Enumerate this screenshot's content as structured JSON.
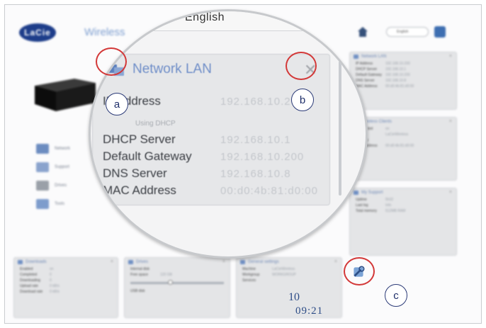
{
  "header": {
    "logo": "LaCie",
    "title": "Wireless",
    "lang_zoomed": "English",
    "lang_small": "English"
  },
  "network_panel": {
    "title": "Network LAN",
    "rows": [
      {
        "label": "IP Address",
        "value": "192.168.10.200"
      },
      {
        "label": "DHCP Server",
        "value": "192.168.10.1"
      },
      {
        "label": "Default Gateway",
        "value": "192.168.10.200"
      },
      {
        "label": "DNS Server",
        "value": "192.168.10.8"
      },
      {
        "label": "MAC Address",
        "value": "00:d0:4b:81:d0:00"
      }
    ],
    "sub_text": "Using DHCP"
  },
  "sidebar": {
    "items": [
      {
        "label": "Network"
      },
      {
        "label": "Support"
      },
      {
        "label": "Drives"
      },
      {
        "label": "Tools"
      }
    ]
  },
  "right_widgets": {
    "network": {
      "title": "Network LAN",
      "rows": [
        {
          "k": "IP Address",
          "v": "192.168.10.200"
        },
        {
          "k": "DHCP Server",
          "v": "192.168.10.1"
        },
        {
          "k": "Default Gateway",
          "v": "192.168.10.200"
        },
        {
          "k": "DNS Server",
          "v": "192.168.10.8"
        },
        {
          "k": "MAC Address",
          "v": "00:d0:4b:81:d0:00"
        }
      ]
    },
    "wireless": {
      "title": "Wireless Clients",
      "rows": [
        {
          "k": "Connected",
          "v": "on"
        },
        {
          "k": "SSID",
          "v": "LaCieWireless"
        },
        {
          "k": "Security",
          "v": ""
        },
        {
          "k": "MAC Address",
          "v": "00:d0:4b:81:d0:00"
        }
      ]
    },
    "support": {
      "title": "My Support",
      "rows": [
        {
          "k": "Uptime",
          "v": "5h32"
        },
        {
          "k": "Last log",
          "v": "Info"
        },
        {
          "k": "Total memory",
          "v": "512MB RAM"
        }
      ]
    }
  },
  "bottom_widgets": {
    "downloads": {
      "title": "Downloads",
      "rows": [
        {
          "k": "Enabled",
          "v": "on"
        },
        {
          "k": "Completed",
          "v": "0"
        },
        {
          "k": "Downloading",
          "v": "0"
        },
        {
          "k": "Upload rate",
          "v": "0 kB/s"
        },
        {
          "k": "Download rate",
          "v": "0 kB/s"
        }
      ]
    },
    "drives": {
      "title": "Drives",
      "rows": [
        {
          "k": "Internal disk",
          "v": ""
        },
        {
          "k": "Free space",
          "v": "120 GB"
        },
        {
          "k": "USB disk",
          "v": ""
        }
      ]
    },
    "general": {
      "title": "General settings",
      "rows": [
        {
          "k": "Machine",
          "v": "LaCieWireless"
        },
        {
          "k": "Workgroup",
          "v": "WORKGROUP"
        },
        {
          "k": "Services",
          "v": ""
        }
      ],
      "clock_top": "10",
      "clock_bottom": "09:21"
    }
  },
  "callouts": {
    "a": "a",
    "b": "b",
    "c": "c"
  },
  "colors": {
    "accent_blue": "#6f8ec8",
    "callout_ring": "#d33838",
    "callout_badge": "#2b3a77"
  },
  "icons": {
    "panel": "network-lan-icon",
    "close": "close-icon",
    "settings": "wrench-settings-icon"
  }
}
